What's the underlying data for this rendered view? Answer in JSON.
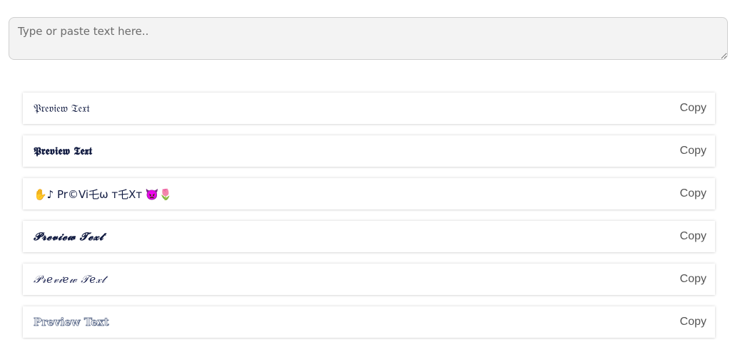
{
  "input": {
    "placeholder": "Type or paste text here..",
    "value": ""
  },
  "results": [
    {
      "text": "𝔓𝔯𝔢𝔳𝔦𝔢𝔴 𝔗𝔢𝔵𝔱",
      "copy_label": "Copy"
    },
    {
      "text": "𝕻𝖗𝖊𝖛𝖎𝖊𝖜 𝕿𝖊𝖝𝖙",
      "copy_label": "Copy"
    },
    {
      "text": "✋♪  Pr©Vi乇ω т乇Xт  👿🌷",
      "copy_label": "Copy"
    },
    {
      "text": "𝓟𝓻𝓮𝓿𝓲𝓮𝔀 𝓣𝓮𝔁𝓽",
      "copy_label": "Copy"
    },
    {
      "text": "𝒫𝓇𝑒𝓋𝒾𝑒𝓌 𝒯𝑒𝓍𝓉",
      "copy_label": "Copy"
    },
    {
      "text": "Preview Text",
      "copy_label": "Copy"
    }
  ]
}
